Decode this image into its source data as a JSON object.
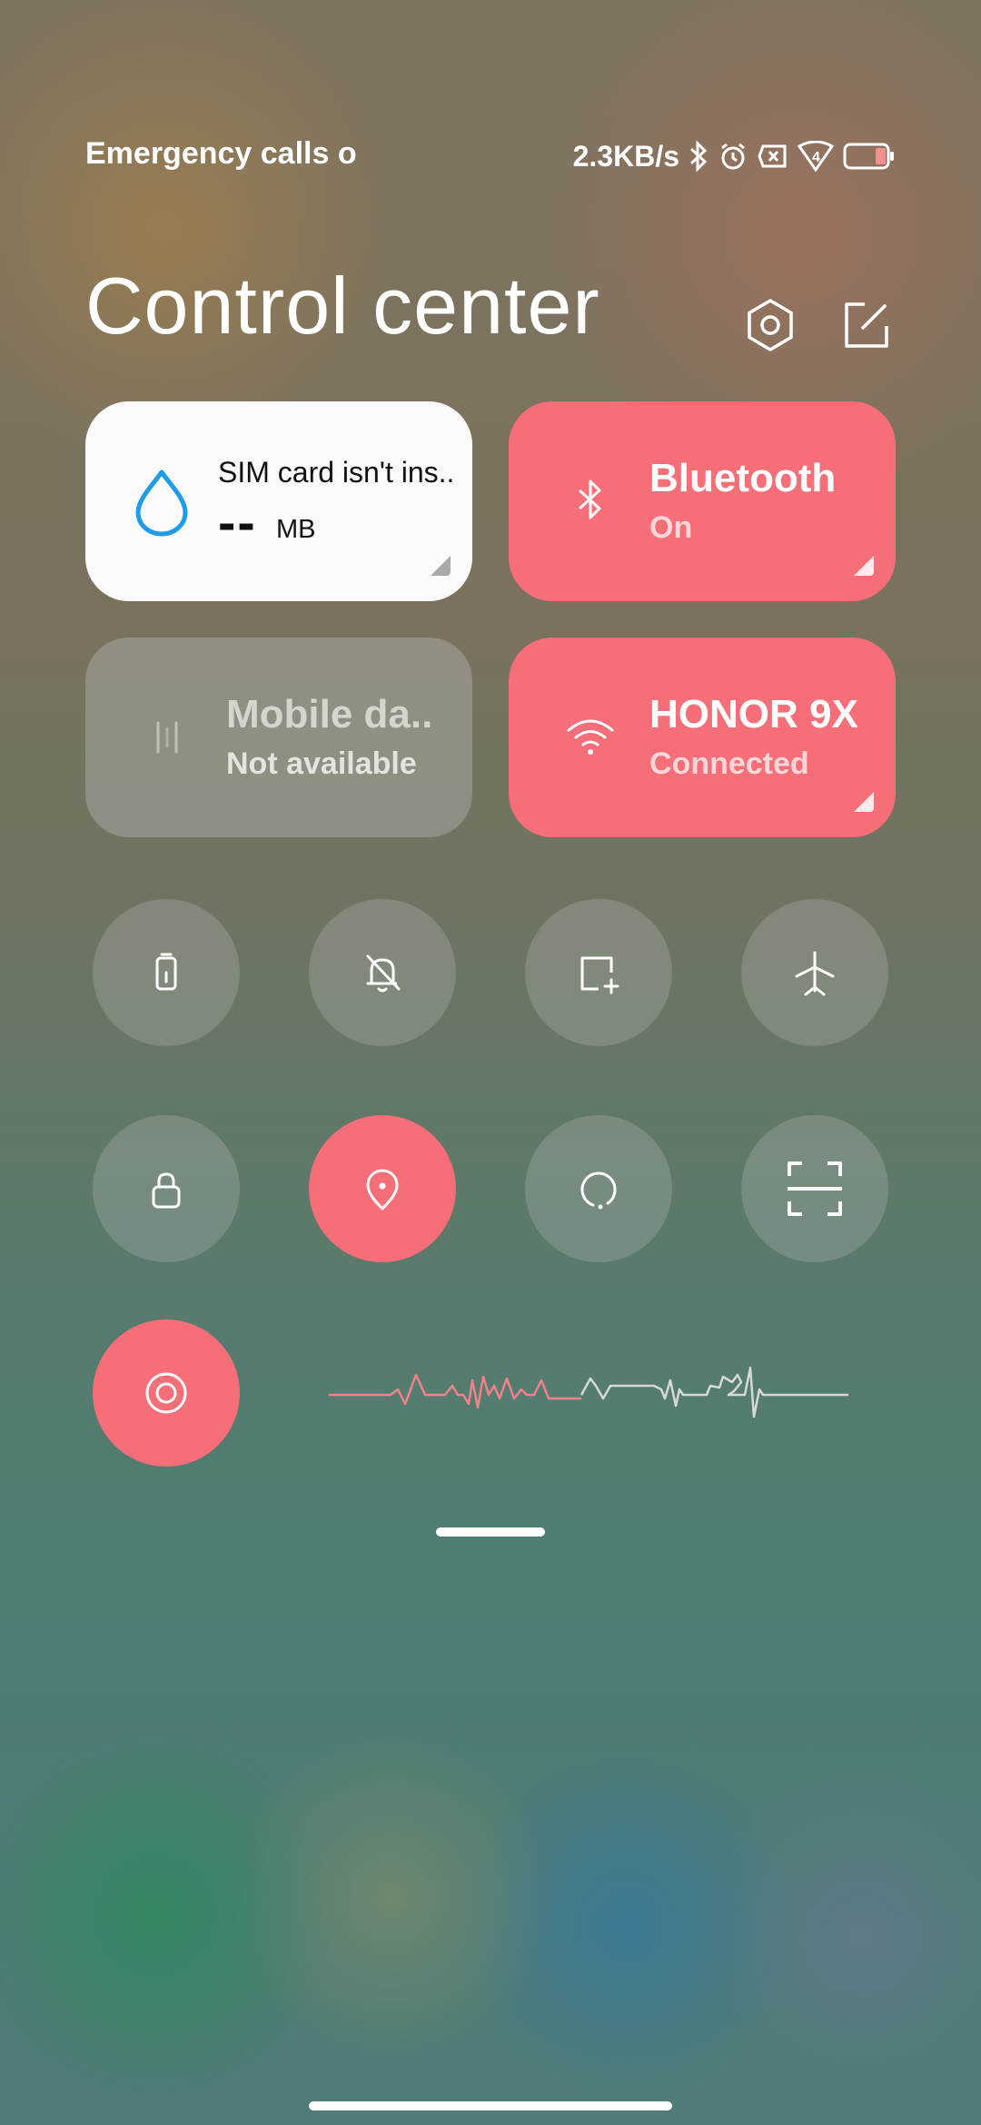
{
  "status_bar": {
    "carrier_text": "Emergency calls o",
    "carrier_fade": "",
    "net_speed": "2.3KB/s",
    "icons": [
      "bluetooth-icon",
      "alarm-icon",
      "sim-missing-icon",
      "wifi-4-icon",
      "battery-icon"
    ],
    "wifi_badge": "4"
  },
  "header": {
    "title": "Control center",
    "icons": [
      "settings-icon",
      "edit-icon"
    ]
  },
  "tiles": {
    "data_usage": {
      "title": "SIM card isn't ins..",
      "value": "--",
      "unit": "MB",
      "icon": "water-drop-icon"
    },
    "bluetooth": {
      "title": "Bluetooth",
      "status": "On",
      "icon": "bluetooth-icon"
    },
    "mobile_data": {
      "title": "Mobile da..",
      "status": "Not available",
      "icon": "mobile-data-icon"
    },
    "wifi": {
      "title": "HONOR 9X",
      "status": "Connected",
      "icon": "wifi-icon"
    }
  },
  "toggles": [
    {
      "name": "battery-saver",
      "icon": "battery-saver-icon",
      "active": false
    },
    {
      "name": "silent-mode",
      "icon": "bell-off-icon",
      "active": false
    },
    {
      "name": "screenshot",
      "icon": "screenshot-icon",
      "active": false
    },
    {
      "name": "airplane-mode",
      "icon": "airplane-icon",
      "active": false
    },
    {
      "name": "lock-screen",
      "icon": "lock-icon",
      "active": false
    },
    {
      "name": "location",
      "icon": "location-pin-icon",
      "active": true
    },
    {
      "name": "auto-rotate",
      "icon": "rotate-icon",
      "active": false
    },
    {
      "name": "scanner",
      "icon": "scan-icon",
      "active": false
    },
    {
      "name": "focus-mode",
      "icon": "target-icon",
      "active": true
    }
  ],
  "colors": {
    "accent": "#f56e78",
    "tile_inactive": "rgba(200,200,200,0.33)",
    "data_tile_bg": "#fafafa",
    "drop_icon": "#1e9bea"
  }
}
